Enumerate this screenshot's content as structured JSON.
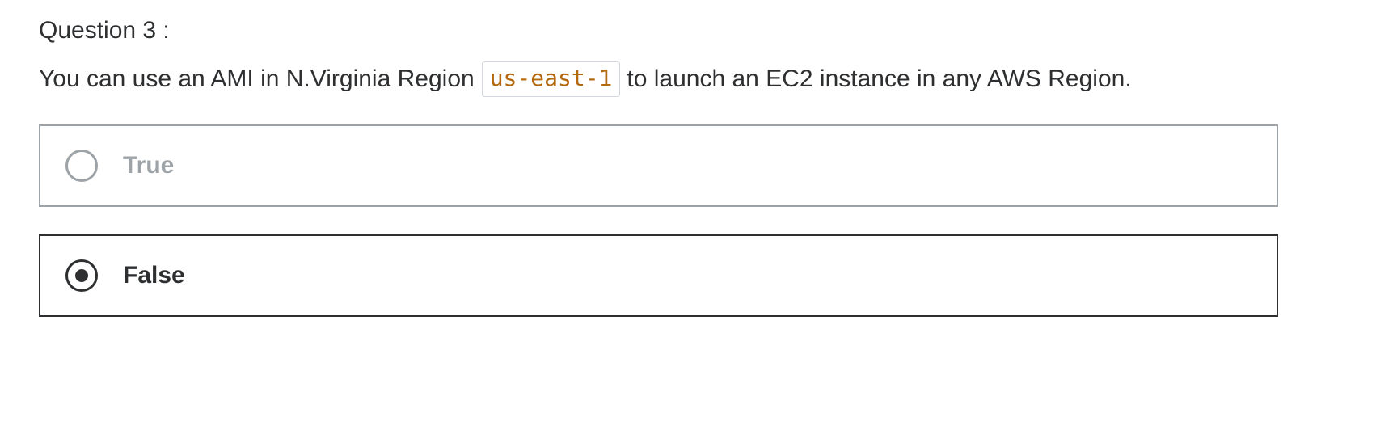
{
  "question": {
    "title": "Question 3 :",
    "prompt_before": "You can use an AMI in N.Virginia Region",
    "code": "us-east-1",
    "prompt_after": "to launch an EC2 instance in any AWS Region."
  },
  "options": [
    {
      "label": "True",
      "selected": false
    },
    {
      "label": "False",
      "selected": true
    }
  ],
  "colors": {
    "text": "#2d2f31",
    "muted": "#9da3a7",
    "code": "#b4690e",
    "code_border": "#d1d7dc"
  }
}
